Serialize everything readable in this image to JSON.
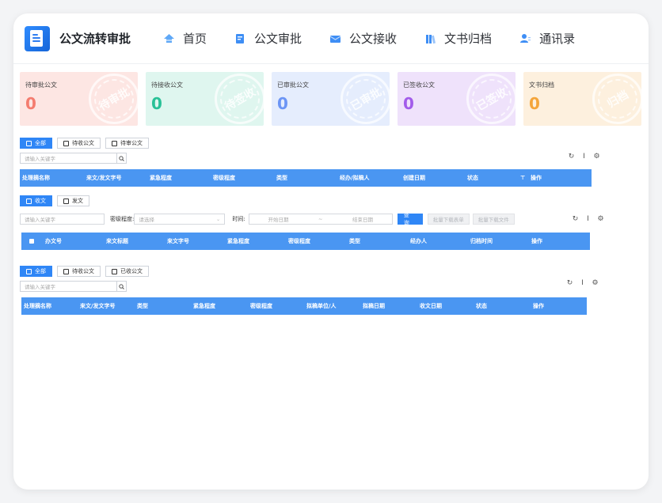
{
  "app": {
    "title": "公文流转审批"
  },
  "nav": [
    {
      "label": "首页",
      "icon": "home-icon"
    },
    {
      "label": "公文审批",
      "icon": "document-icon"
    },
    {
      "label": "公文接收",
      "icon": "inbox-icon"
    },
    {
      "label": "文书归档",
      "icon": "archive-icon"
    },
    {
      "label": "通讯录",
      "icon": "contacts-icon"
    }
  ],
  "cards": [
    {
      "label": "待审批公文",
      "value": "0",
      "stamp": "待审批",
      "bg": "#fde6e3",
      "color": "#f47c6f"
    },
    {
      "label": "待接收公文",
      "value": "0",
      "stamp": "待签收",
      "bg": "#dff6ef",
      "color": "#29c197"
    },
    {
      "label": "已审批公文",
      "value": "0",
      "stamp": "已审批",
      "bg": "#e5edfd",
      "color": "#6c95f5"
    },
    {
      "label": "已签收公文",
      "value": "0",
      "stamp": "已签收",
      "bg": "#efe2fb",
      "color": "#a25cea"
    },
    {
      "label": "文书归档",
      "value": "0",
      "stamp": "归档",
      "bg": "#fdf0de",
      "color": "#f4a53a"
    }
  ],
  "section1": {
    "tabs": [
      "全部",
      "待收公文",
      "待审公文"
    ],
    "search_placeholder": "请输入关键字",
    "columns": [
      "处理摘名称",
      "来文/发文字号",
      "紧急程度",
      "密级程度",
      "类型",
      "经办/拟稿人",
      "创建日期",
      "状态",
      "操作"
    ]
  },
  "section2": {
    "tabs": [
      "收文",
      "发文"
    ],
    "keyword_placeholder": "请输入关键字",
    "secret_label": "密级程度:",
    "secret_placeholder": "请选择",
    "time_label": "时间:",
    "start_placeholder": "开始日期",
    "date_sep": "~",
    "end_placeholder": "结束日期",
    "query_label": "查 询",
    "batch_form_label": "批量下载表单",
    "batch_file_label": "批量下载文件",
    "columns": [
      "办文号",
      "来文标题",
      "来文字号",
      "紧急程度",
      "密级程度",
      "类型",
      "经办人",
      "归档时间",
      "操作"
    ]
  },
  "section3": {
    "tabs": [
      "全部",
      "待收公文",
      "已收公文"
    ],
    "search_placeholder": "请输入关键字",
    "columns": [
      "处理摘名称",
      "来文/发文字号",
      "类型",
      "紧急程度",
      "密级程度",
      "拟稿单位/人",
      "拟稿日期",
      "收文日期",
      "状态",
      "操作"
    ]
  },
  "colors": {
    "accent": "#2f86f6",
    "table_header": "#4a96f2"
  }
}
